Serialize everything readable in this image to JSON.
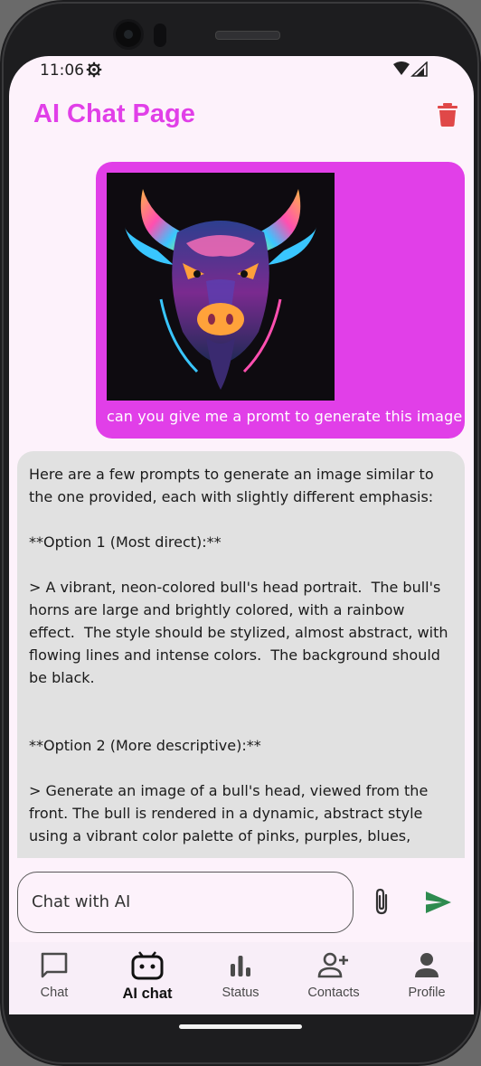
{
  "status_bar": {
    "time": "11:06"
  },
  "app_bar": {
    "title": "AI Chat Page"
  },
  "messages": [
    {
      "role": "user",
      "image_alt": "neon bull head",
      "text": "can you give me a promt to generate this image"
    },
    {
      "role": "ai",
      "text": "Here are a few prompts to generate an image similar to the one provided, each with slightly different emphasis:\n\n**Option 1 (Most direct):**\n\n> A vibrant, neon-colored bull's head portrait.  The bull's horns are large and brightly colored, with a rainbow effect.  The style should be stylized, almost abstract, with flowing lines and intense colors.  The background should be black.\n\n\n**Option 2 (More descriptive):**\n\n> Generate an image of a bull's head, viewed from the front. The bull is rendered in a dynamic, abstract style using a vibrant color palette of pinks, purples, blues,"
    }
  ],
  "composer": {
    "placeholder": "Chat with AI"
  },
  "nav": {
    "items": [
      {
        "label": "Chat",
        "icon": "chat-bubble-icon"
      },
      {
        "label": "AI chat",
        "icon": "robot-icon"
      },
      {
        "label": "Status",
        "icon": "bar-chart-icon"
      },
      {
        "label": "Contacts",
        "icon": "add-person-icon"
      },
      {
        "label": "Profile",
        "icon": "person-icon"
      }
    ],
    "active": "AI chat"
  },
  "colors": {
    "accent": "#e13fe8",
    "send": "#2e8b4f",
    "trash": "#e04848",
    "background": "#fdf2fb",
    "ai_bubble": "#e1e1e1"
  }
}
